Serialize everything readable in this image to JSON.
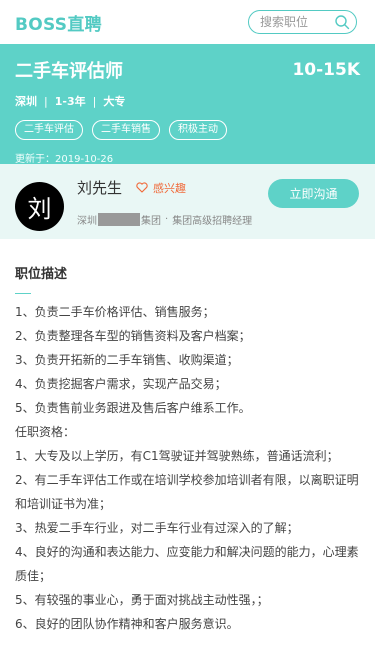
{
  "header": {
    "logo": "BOSS直聘",
    "search_placeholder": "搜索职位"
  },
  "job": {
    "title": "二手车评估师",
    "salary": "10-15K",
    "city": "深圳",
    "experience": "1-3年",
    "education": "大专",
    "tags": [
      "二手车评估",
      "二手车销售",
      "积极主动"
    ],
    "updated": "更新于：2019-10-26"
  },
  "recruiter": {
    "avatar_char": "刘",
    "name": "刘先生",
    "interest": "感兴趣",
    "company_prefix": "深圳",
    "company_suffix": "集团",
    "dot": "·",
    "position": "集团高级招聘经理",
    "chat_button": "立即沟通"
  },
  "description": {
    "heading": "职位描述",
    "lines": [
      "1、负责二手车价格评估、销售服务；",
      "2、负责整理各车型的销售资料及客户档案；",
      "3、负责开拓新的二手车销售、收购渠道；",
      "4、负责挖掘客户需求，实现产品交易；",
      "5、负责售前业务跟进及售后客户维系工作。",
      "任职资格：",
      "1、大专及以上学历，有C1驾驶证并驾驶熟练，普通话流利；",
      "2、有二手车评估工作或在培训学校参加培训者有限，以离职证明和培训证书为准；",
      "3、热爱二手车行业，对二手车行业有过深入的了解；",
      "4、良好的沟通和表达能力、应变能力和解决问题的能力，心理素质佳；",
      "5、有较强的事业心，勇于面对挑战主动性强，；",
      "6、良好的团队协作精神和客户服务意识。"
    ]
  },
  "colors": {
    "accent": "#5ed2c8",
    "interest": "#f06a3a"
  }
}
